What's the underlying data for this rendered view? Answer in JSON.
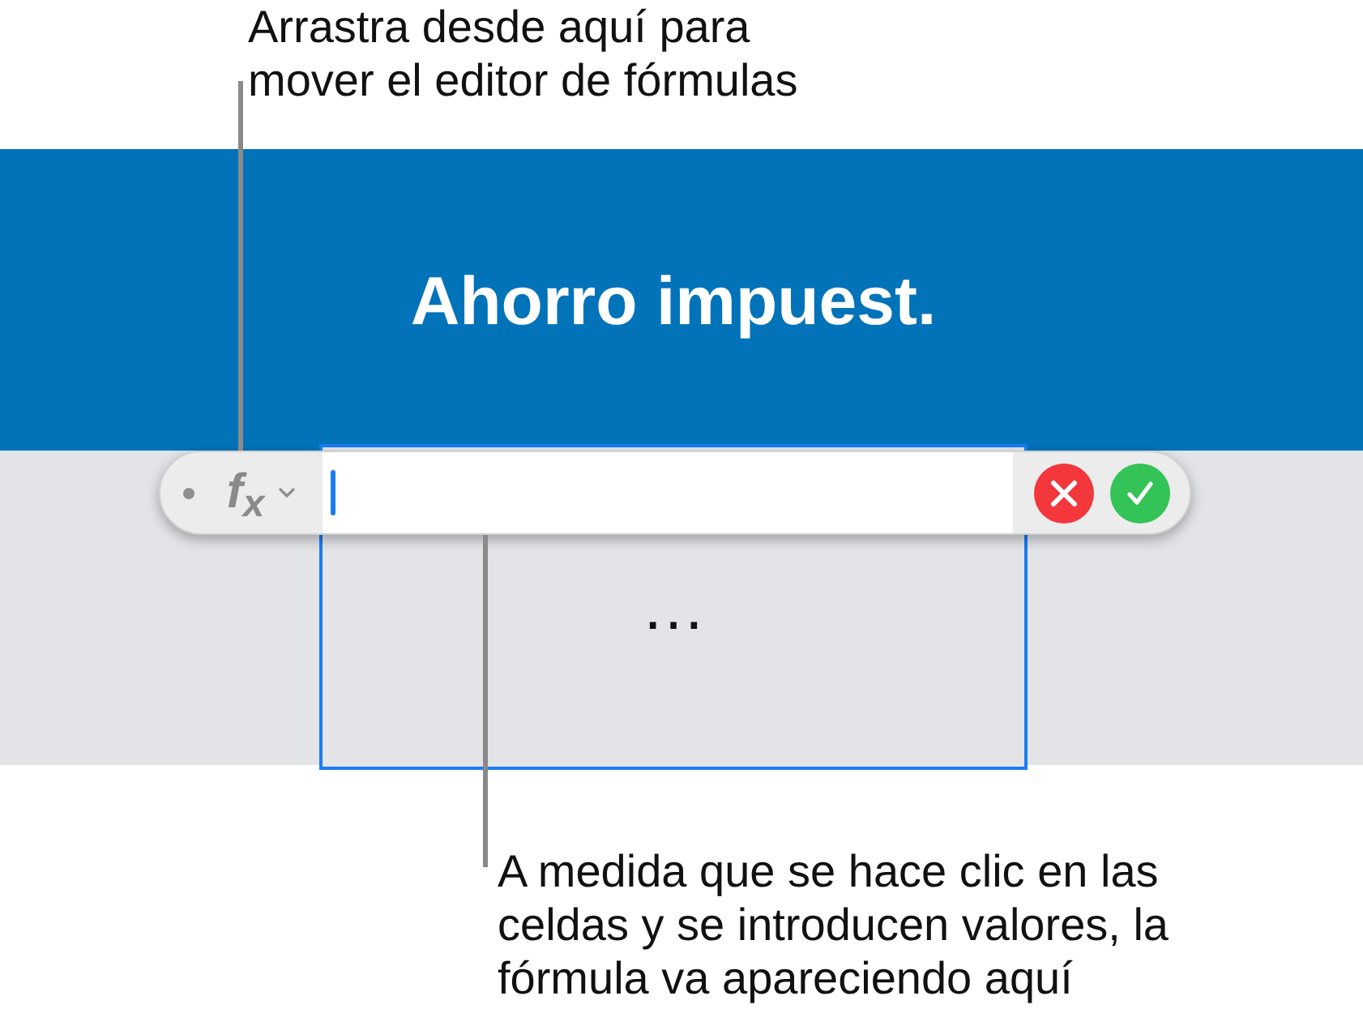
{
  "callouts": [
    {
      "text": "Arrastra desde aquí para\nmover el editor de fórmulas"
    },
    {
      "text": "A medida que se hace clic en las\nceldas y se introducen valores, la\nfórmula va apareciendo aquí"
    }
  ],
  "header_row": {
    "title": "Ahorro impuest."
  },
  "selected_cell": {
    "value": "…",
    "selected": true
  },
  "formula_editor": {
    "function_label": "f$_{x}$"
  }
}
